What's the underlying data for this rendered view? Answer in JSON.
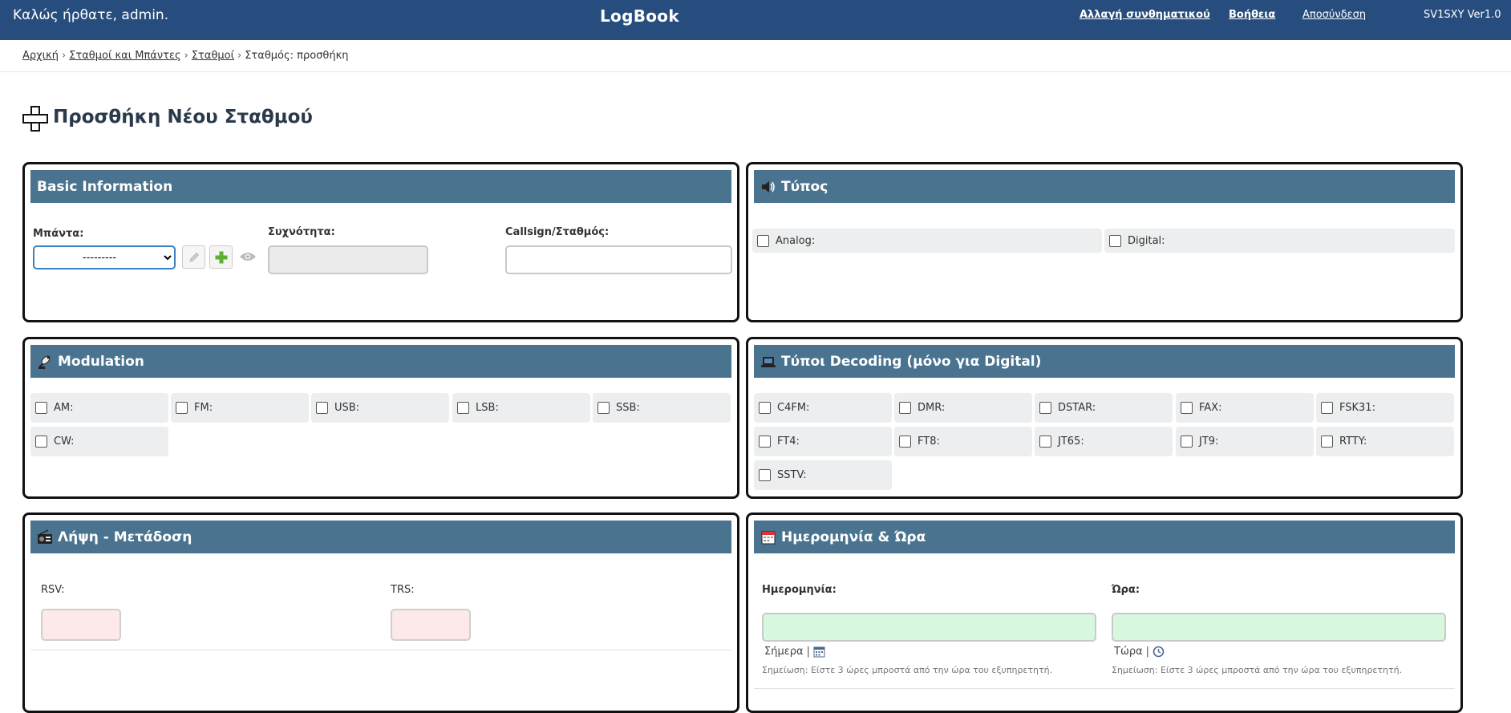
{
  "header": {
    "welcome": "Καλώς ήρθατε, admin.",
    "brand": "LogBook",
    "nav": {
      "change_password": "Αλλαγή συνθηματικού",
      "help": "Βοήθεια",
      "logout": "Αποσύνδεση"
    },
    "version": "SV1SXY Ver1.0"
  },
  "breadcrumb": {
    "items": [
      "Αρχική",
      "Σταθμοί και Μπάντες",
      "Σταθμοί"
    ],
    "current": "Σταθμός: προσθήκη",
    "separator": "›"
  },
  "page_title": "Προσθήκη Νέου Σταθμού",
  "basic": {
    "title": "Basic Information",
    "band_label": "Μπάντα:",
    "band_selected": "---------",
    "frequency_label": "Συχνότητα:",
    "callsign_label": "Callsign/Σταθμός:"
  },
  "type": {
    "title": "Τύπος",
    "options": [
      "Analog:",
      "Digital:"
    ]
  },
  "modulation": {
    "title": "Modulation",
    "options": [
      "AM:",
      "FM:",
      "USB:",
      "LSB:",
      "SSB:",
      "CW:"
    ]
  },
  "decoding": {
    "title": "Τύποι Decoding (μόνο για Digital)",
    "options": [
      "C4FM:",
      "DMR:",
      "DSTAR:",
      "FAX:",
      "FSK31:",
      "FT4:",
      "FT8:",
      "JT65:",
      "JT9:",
      "RTTY:",
      "SSTV:"
    ]
  },
  "rxtx": {
    "title": "Λήψη - Μετάδοση",
    "rsv_label": "RSV:",
    "trs_label": "TRS:"
  },
  "datetime": {
    "title": "Ημερομηνία & Ώρα",
    "date_label": "Ημερομηνία:",
    "time_label": "Ώρα:",
    "today_link": "Σήμερα",
    "now_link": "Τώρα",
    "pipe": "|",
    "note": "Σημείωση: Είστε 3 ώρες μπροστά από την ώρα του εξυπηρετητή."
  },
  "colors": {
    "header_bg": "#264d7d",
    "panel_head_bg": "#4a7390",
    "add_green": "#5cb130"
  }
}
